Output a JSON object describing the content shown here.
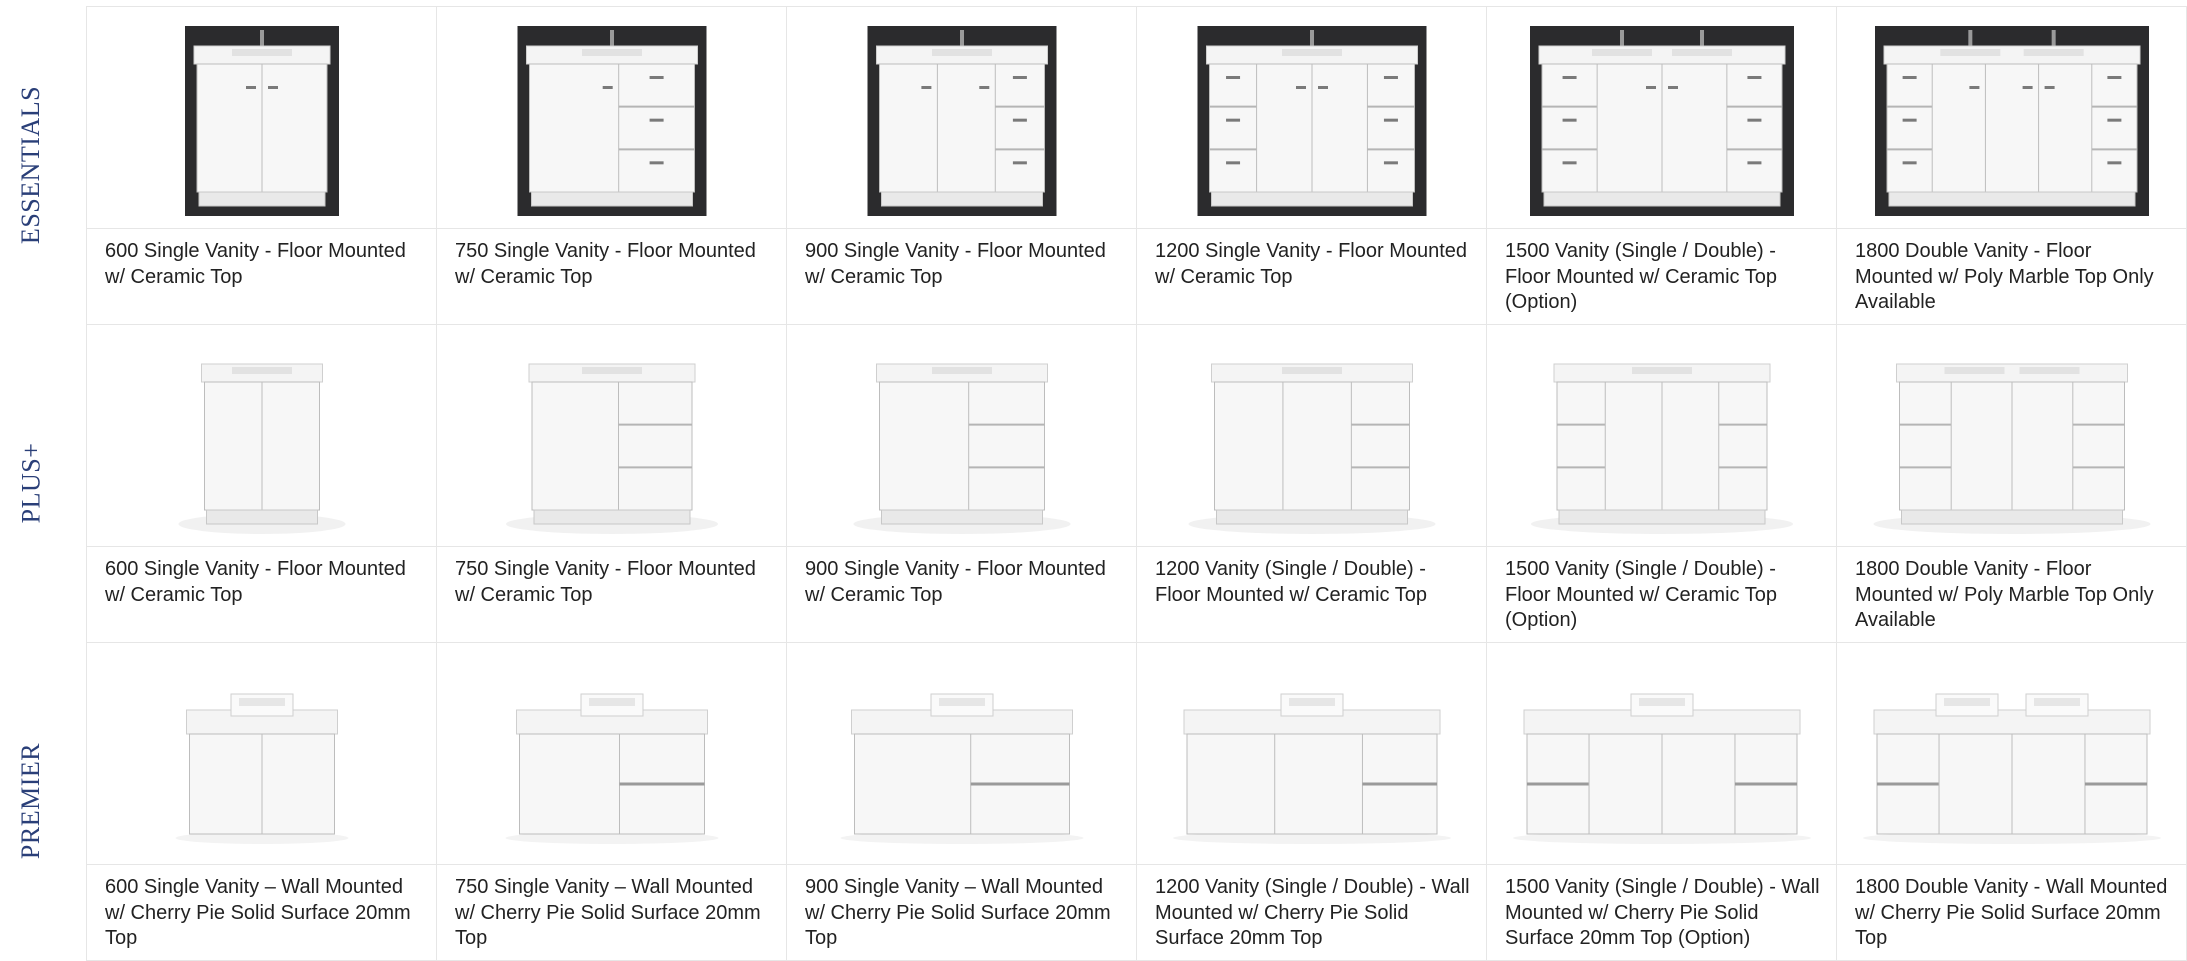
{
  "colors": {
    "row_label": "#2a3f78",
    "grid_line": "#e6e6e6",
    "caption_text": "#222222"
  },
  "rows": [
    {
      "label": "ESSENTIALS",
      "items": [
        {
          "caption": "600 Single Vanity - Floor Mounted w/ Ceramic Top",
          "icon": "vanity-600-floor-image"
        },
        {
          "caption": "750 Single Vanity - Floor Mounted w/ Ceramic Top",
          "icon": "vanity-750-floor-image"
        },
        {
          "caption": "900 Single Vanity - Floor Mounted w/ Ceramic Top",
          "icon": "vanity-900-floor-image"
        },
        {
          "caption": "1200 Single Vanity - Floor Mounted w/ Ceramic Top",
          "icon": "vanity-1200-floor-image"
        },
        {
          "caption": "1500 Vanity (Single / Double) - Floor Mounted w/ Ceramic Top (Option)",
          "icon": "vanity-1500-floor-image"
        },
        {
          "caption": "1800 Double Vanity - Floor Mounted w/ Poly Marble Top Only Available",
          "icon": "vanity-1800-floor-image"
        }
      ]
    },
    {
      "label": "PLUS+",
      "items": [
        {
          "caption": "600 Single Vanity - Floor Mounted w/ Ceramic Top",
          "icon": "vanity-600-floor-image"
        },
        {
          "caption": "750 Single Vanity - Floor Mounted w/ Ceramic Top",
          "icon": "vanity-750-floor-image"
        },
        {
          "caption": "900 Single Vanity - Floor Mounted w/ Ceramic Top",
          "icon": "vanity-900-floor-image"
        },
        {
          "caption": "1200 Vanity (Single / Double) - Floor Mounted w/ Ceramic Top",
          "icon": "vanity-1200-floor-image"
        },
        {
          "caption": "1500 Vanity (Single / Double) - Floor Mounted w/ Ceramic Top (Option)",
          "icon": "vanity-1500-floor-image"
        },
        {
          "caption": "1800 Double Vanity - Floor Mounted w/ Poly Marble Top Only Available",
          "icon": "vanity-1800-floor-image"
        }
      ]
    },
    {
      "label": "PREMIER",
      "items": [
        {
          "caption": "600 Single Vanity – Wall Mounted w/ Cherry Pie Solid Surface 20mm Top",
          "icon": "vanity-600-wall-image"
        },
        {
          "caption": "750 Single Vanity – Wall Mounted w/ Cherry Pie Solid Surface 20mm Top",
          "icon": "vanity-750-wall-image"
        },
        {
          "caption": "900 Single Vanity – Wall Mounted w/ Cherry Pie Solid Surface 20mm Top",
          "icon": "vanity-900-wall-image"
        },
        {
          "caption": "1200 Vanity (Single / Double) - Wall Mounted w/ Cherry Pie Solid Surface 20mm Top",
          "icon": "vanity-1200-wall-image"
        },
        {
          "caption": "1500 Vanity (Single / Double) - Wall Mounted w/ Cherry Pie Solid Surface 20mm Top (Option)",
          "icon": "vanity-1500-wall-image"
        },
        {
          "caption": "1800 Double Vanity - Wall Mounted w/ Cherry Pie Solid Surface 20mm Top",
          "icon": "vanity-1800-wall-image"
        }
      ]
    }
  ]
}
